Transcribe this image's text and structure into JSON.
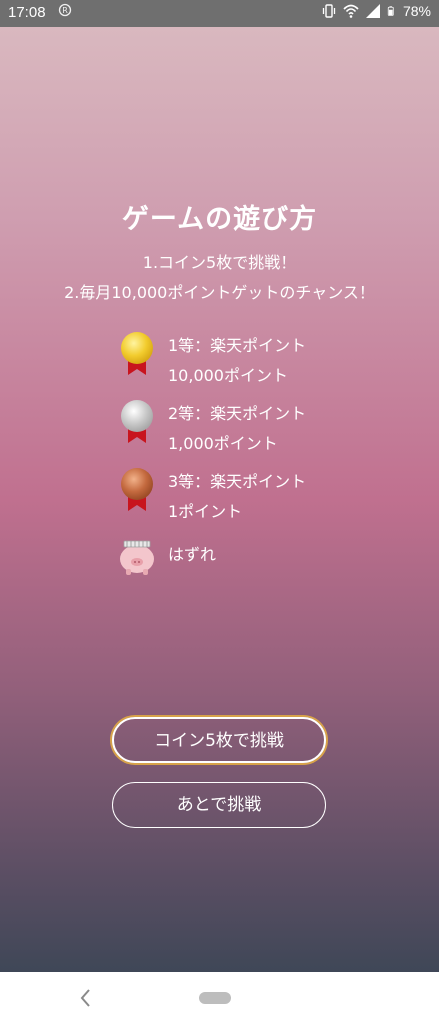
{
  "status_bar": {
    "time": "17:08",
    "notification_icon": "app-notification-icon",
    "battery": "78%",
    "icons": [
      "vibrate-icon",
      "wifi-icon",
      "signal-icon",
      "battery-icon"
    ]
  },
  "game_info": {
    "title": "ゲームの遊び方",
    "rules": [
      "1.コイン5枚で挑戦！",
      "2.毎月10,000ポイントゲットのチャンス！"
    ]
  },
  "prizes": [
    {
      "rank": "1等：楽天ポイント",
      "amount": "10,000ポイント",
      "icon": "gold-medal-icon",
      "color": "#f2cc2e"
    },
    {
      "rank": "2等：楽天ポイント",
      "amount": "1,000ポイント",
      "icon": "silver-medal-icon",
      "color": "#c9c9c9"
    },
    {
      "rank": "3等：楽天ポイント",
      "amount": "1ポイント",
      "icon": "bronze-medal-icon",
      "color": "#c46a3f"
    },
    {
      "rank": "はずれ",
      "icon": "pig-miss-icon",
      "color": "#f3c6cc"
    }
  ],
  "buttons": {
    "primary": "コイン5枚で挑戦",
    "secondary": "あとで挑戦"
  },
  "colors": {
    "ribbon": "#c8141e",
    "primary_button_outline": "#d7a24a",
    "background_top": "#d9b8bf",
    "background_mid": "#c0708f",
    "background_bottom": "#3f4757"
  },
  "nav_bar": {
    "icons": [
      "back-icon",
      "home-pill-icon"
    ]
  }
}
